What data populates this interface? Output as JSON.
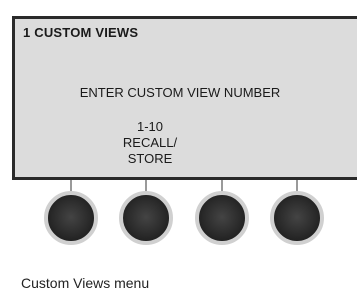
{
  "screen": {
    "title": "1  CUSTOM VIEWS",
    "prompt": "ENTER CUSTOM VIEW NUMBER",
    "softkey_label_lines": [
      "1-10",
      "RECALL/",
      "STORE"
    ]
  },
  "caption": "Custom Views menu"
}
